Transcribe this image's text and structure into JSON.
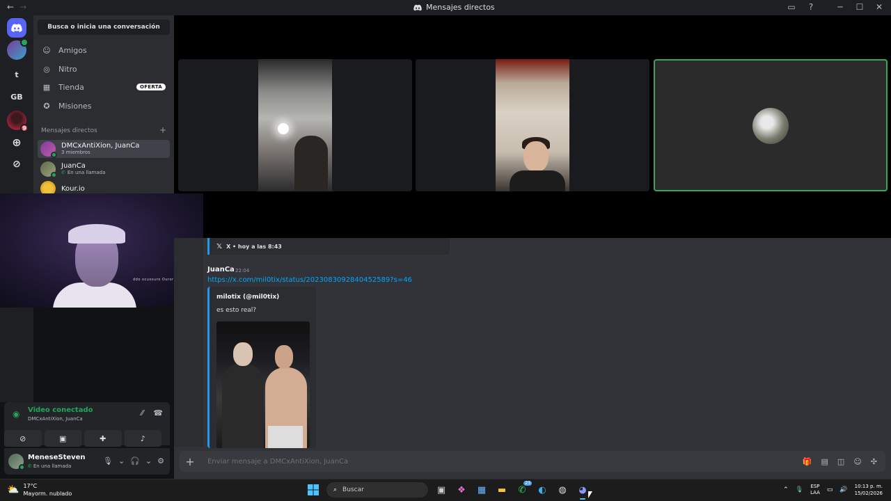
{
  "titlebar": {
    "back_icon": "←",
    "forward_icon": "→",
    "title": "Mensajes directos",
    "inbox_icon": "▭",
    "help_icon": "?",
    "minimize": "─",
    "maximize": "☐",
    "close": "✕"
  },
  "guilds": [
    {
      "name": "home",
      "label": ""
    },
    {
      "name": "server-avatar",
      "label": ""
    },
    {
      "name": "server-t",
      "label": "t"
    },
    {
      "name": "server-gb",
      "label": "GB"
    },
    {
      "name": "server-red",
      "label": "",
      "badge": "9"
    }
  ],
  "dm_panel": {
    "search_label": "Busca o inicia una conversación",
    "nav": [
      {
        "label": "Amigos",
        "icon": "friends-icon"
      },
      {
        "label": "Nitro",
        "icon": "nitro-icon"
      },
      {
        "label": "Tienda",
        "icon": "shop-icon",
        "tag": "OFERTA"
      },
      {
        "label": "Misiones",
        "icon": "quests-icon"
      }
    ],
    "section_title": "Mensajes directos",
    "section_add": "+",
    "dms": [
      {
        "name": "DMCxAntiXion, JuanCa",
        "sub": "3 miembros",
        "active": true
      },
      {
        "name": "JuanCa",
        "sub": "En una llamada",
        "call": true
      },
      {
        "name": "Kour.io",
        "sub": ""
      }
    ]
  },
  "selfcam": {
    "overlay_text": "ddo ocuosuro Ouror"
  },
  "voice": {
    "status": "Video conectado",
    "channel": "DMCxAntiXion, JuanCa"
  },
  "user": {
    "name": "MeneseSteven",
    "status": "En una llamada"
  },
  "chat": {
    "embed_top_source": "X • hoy a las 8:43",
    "author": "JuanCa",
    "time": "22:04",
    "link": "https://x.com/mil0tix/status/2023083092840452589?s=46",
    "embed_author": "milotix (@mil0tix)",
    "embed_text": "es esto real?",
    "composer_placeholder": "Enviar mensaje a DMCxAntiXion, JuanCa"
  },
  "taskbar": {
    "temp": "17°C",
    "weather": "Mayorm. nublado",
    "search": "Buscar",
    "whatsapp_badge": "23",
    "lang1": "ESP",
    "lang2": "LAA",
    "time": "10:13 p. m.",
    "date": "15/02/2026"
  }
}
